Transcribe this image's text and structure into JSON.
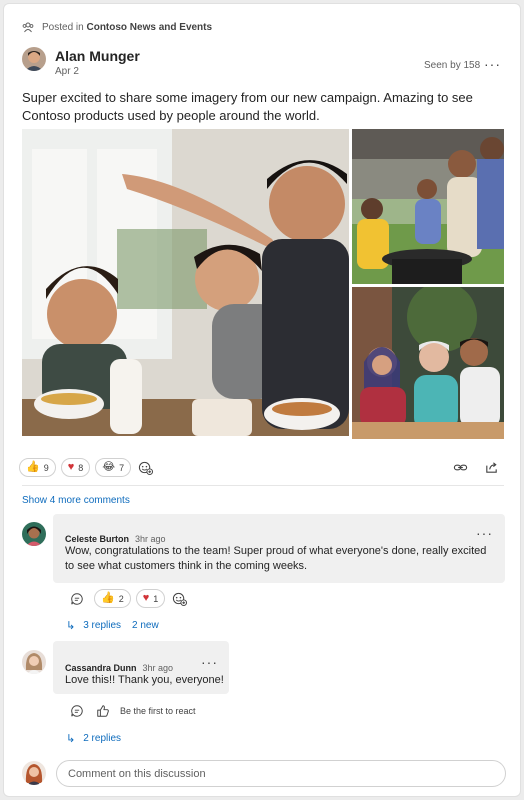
{
  "post": {
    "posted_prefix": "Posted in",
    "community": "Contoso News and Events",
    "author": "Alan Munger",
    "date": "Apr 2",
    "seen": "Seen by 158",
    "more": "···",
    "body": "Super excited to share some imagery from our new campaign. Amazing to see Contoso products used by people around the world."
  },
  "reactions": [
    {
      "emoji": "👍",
      "count": "9"
    },
    {
      "emoji": "♥",
      "count": "8"
    },
    {
      "emoji": "😂",
      "count": "7"
    }
  ],
  "show_more_comments": "Show 4 more comments",
  "comments": [
    {
      "name": "Celeste Burton",
      "time": "3hr ago",
      "text": "Wow, congratulations to the team! Super proud of what everyone's done, really excited to see what customers think in the coming weeks.",
      "reactions": [
        {
          "emoji": "👍",
          "count": "2"
        },
        {
          "emoji": "♥",
          "count": "1"
        }
      ],
      "replies": "3 replies",
      "new": "2 new"
    },
    {
      "name": "Cassandra Dunn",
      "time": "3hr ago",
      "text": "Love this!! Thank you, everyone!",
      "first_react": "Be the first to react",
      "replies": "2 replies"
    }
  ],
  "comment_input": {
    "placeholder": "Comment on this discussion"
  },
  "colors": {
    "accent": "#0f6cbd",
    "heart": "#d13438",
    "bubble": "#f0f0f0"
  }
}
